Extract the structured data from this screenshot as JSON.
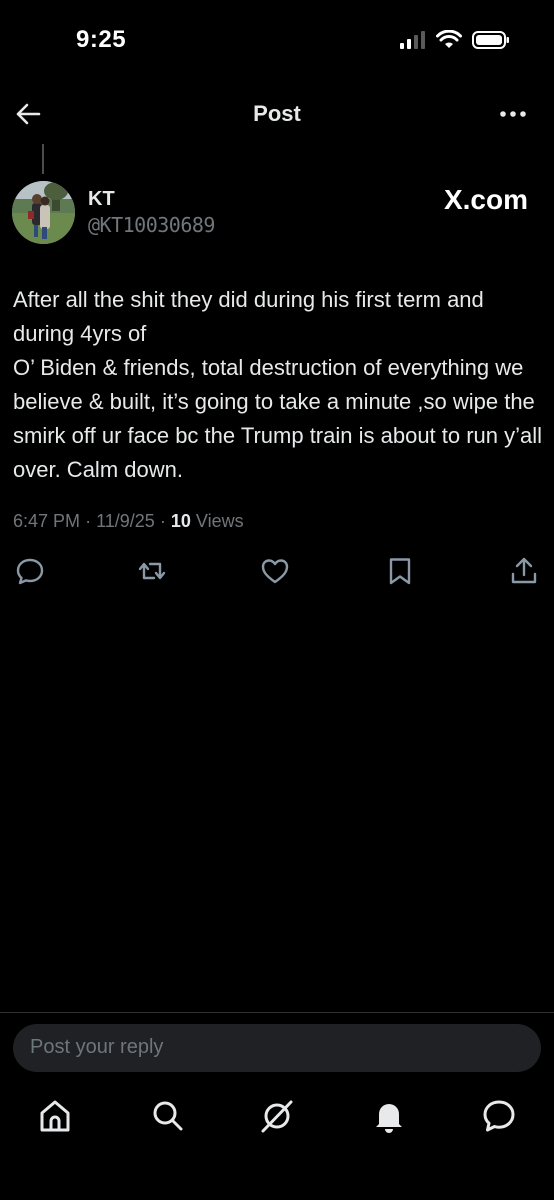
{
  "status_bar": {
    "time": "9:25",
    "icons": [
      "signal-icon",
      "wifi-icon",
      "battery-icon"
    ]
  },
  "header": {
    "title": "Post",
    "back_icon": "arrow-left-icon",
    "more_icon": "more-horizontal-icon"
  },
  "post": {
    "author_name": "KT",
    "author_handle": "@KT10030689",
    "brand_label": "X.com",
    "text": "After all the shit they did during his first term and during 4yrs of\nO’ Biden & friends, total destruction of everything we believe & built, it’s going to take a minute ,so wipe the smirk off ur face bc the Trump train is about to run y’all over. Calm down.",
    "time": "6:47 PM",
    "date": "11/9/25",
    "views_count": "10",
    "views_label": "Views",
    "separator": "·"
  },
  "actions": [
    "reply-icon",
    "repost-icon",
    "like-icon",
    "bookmark-icon",
    "share-icon"
  ],
  "reply": {
    "placeholder": "Post your reply"
  },
  "bottom_nav": [
    "home-icon",
    "search-icon",
    "grok-icon",
    "notifications-icon",
    "messages-icon"
  ],
  "colors": {
    "background": "#000000",
    "text": "#e7e9ea",
    "secondary_text": "#71767b",
    "reply_box": "#1f2124",
    "divider": "#2f3336"
  }
}
